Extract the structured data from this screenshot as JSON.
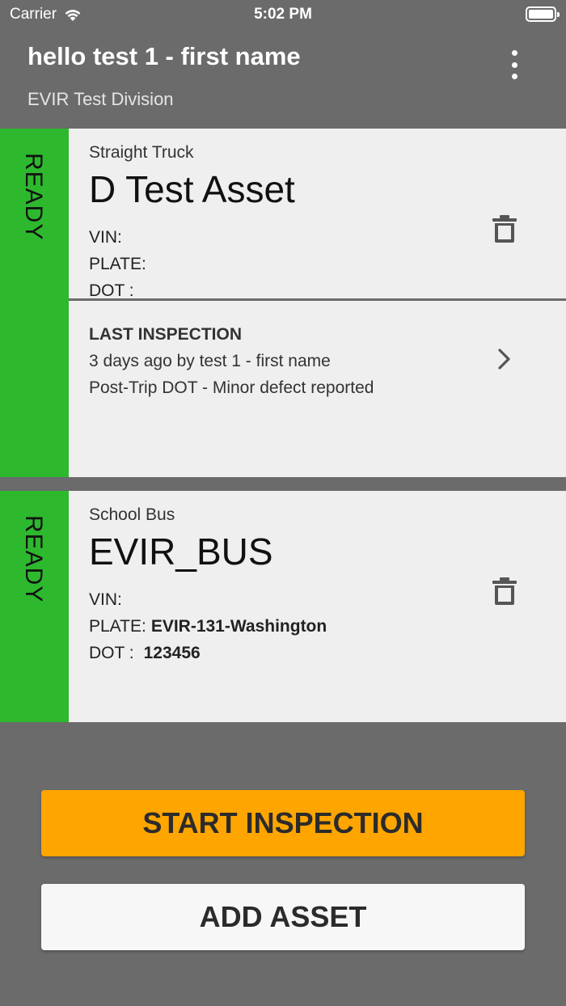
{
  "status_bar": {
    "carrier": "Carrier",
    "time": "5:02 PM"
  },
  "header": {
    "title": "hello test 1 - first name",
    "subtitle": "EVIR Test Division"
  },
  "assets": [
    {
      "status": "READY",
      "type": "Straight Truck",
      "name": "D Test Asset",
      "vin_label": "VIN:",
      "vin": "",
      "plate_label": "PLATE:",
      "plate": "",
      "dot_label": "DOT :",
      "dot": "",
      "last_inspection": {
        "heading": "LAST INSPECTION",
        "line1": "3 days ago by test 1 - first name",
        "line2": "Post-Trip DOT - Minor defect reported"
      }
    },
    {
      "status": "READY",
      "type": "School Bus",
      "name": "EVIR_BUS",
      "vin_label": "VIN:",
      "vin": "",
      "plate_label": "PLATE:",
      "plate": "EVIR-131-Washington",
      "dot_label": "DOT :",
      "dot": "123456"
    }
  ],
  "actions": {
    "start_inspection": "START INSPECTION",
    "add_asset": "ADD ASSET"
  },
  "colors": {
    "background": "#6b6b6b",
    "card": "#efefef",
    "ready": "#2eb82e",
    "primary_button": "#ffa500",
    "secondary_button": "#f7f7f7"
  },
  "icons": {
    "status_wifi": "wifi-icon",
    "status_battery": "battery-icon",
    "menu": "more-vertical-icon",
    "delete": "trash-icon",
    "open": "chevron-right-icon"
  }
}
